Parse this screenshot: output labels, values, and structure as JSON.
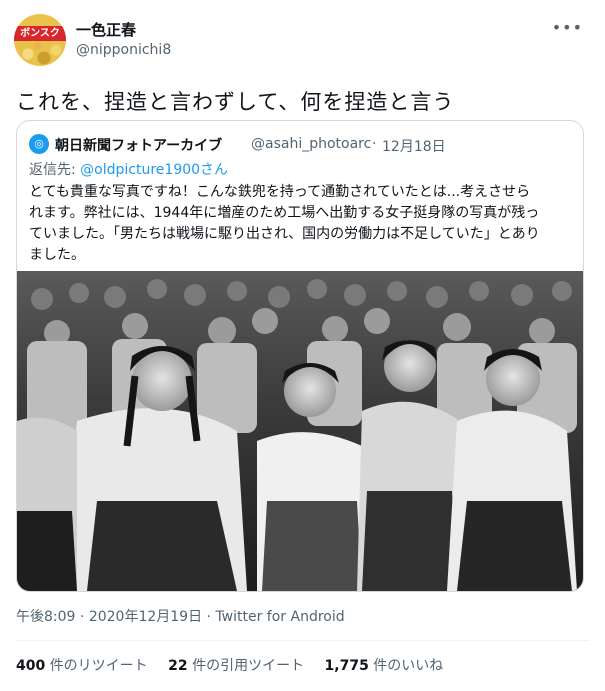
{
  "author": {
    "display_name": "一色正春",
    "handle": "@nipponichi8",
    "avatar_label": "ボンスク"
  },
  "more_icon": "more-dots-icon",
  "tweet_text": "これを、捏造と言わずして、何を捏造と言う",
  "quote": {
    "avatar_icon": "asahi-logo-icon",
    "display_name": "朝日新聞フォトアーカイブ",
    "handle": "@asahi_photoarc",
    "separator": "·",
    "date": "12月18日",
    "reply_prefix": "返信先: ",
    "reply_mention": "@oldpicture1900さん",
    "body_lines": [
      "とても貴重な写真ですね！こんな鉄兜を持って通勤されていたとは...考えさせら",
      "れます。弊社には、1944年に増産のため工場へ出勤する女子挺身隊の写真が残っ",
      "ていました。「男たちは戦場に駆り出され、国内の労働力は不足していた」とあり",
      "ました。"
    ],
    "photo_description": "black-and-white photo of women workers marching"
  },
  "meta": {
    "time": "午後8:09",
    "separator": " · ",
    "date": "2020年12月19日",
    "source": "Twitter for Android"
  },
  "stats": {
    "retweets_count": "400",
    "retweets_label": "件のリツイート",
    "quotes_count": "22",
    "quotes_label": "件の引用ツイート",
    "likes_count": "1,775",
    "likes_label": "件のいいね"
  }
}
